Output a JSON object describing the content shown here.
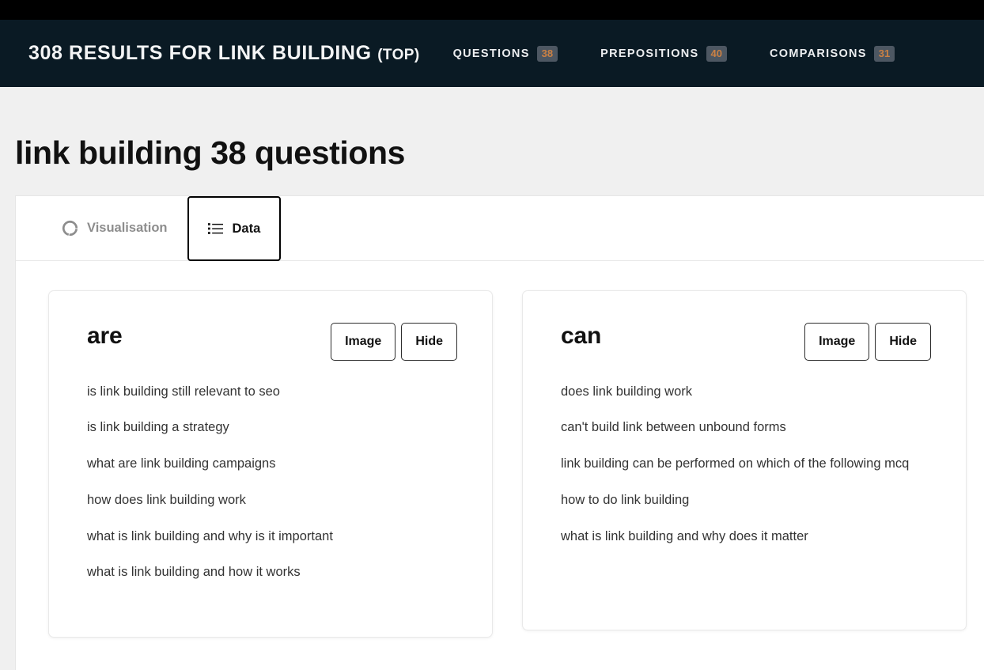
{
  "header": {
    "title_main": "308 RESULTS FOR LINK BUILDING",
    "title_suffix": "(TOP)",
    "nav": [
      {
        "label": "QUESTIONS",
        "count": "38"
      },
      {
        "label": "PREPOSITIONS",
        "count": "40"
      },
      {
        "label": "COMPARISONS",
        "count": "31"
      }
    ],
    "colors": {
      "bar_background": "#0a1a24",
      "top_strip": "#000000",
      "badge_background": "#4d5762",
      "badge_text": "#cb8144"
    }
  },
  "page": {
    "title": "link building 38 questions",
    "background": "#f0f0f0"
  },
  "tabs": [
    {
      "label": "Visualisation",
      "icon": "donut-chart-icon",
      "active": false
    },
    {
      "label": "Data",
      "icon": "list-icon",
      "active": true
    }
  ],
  "cards": [
    {
      "title": "are",
      "image_label": "Image",
      "hide_label": "Hide",
      "items": [
        "is link building still relevant to seo",
        "is link building a strategy",
        "what are link building campaigns",
        "how does link building work",
        "what is link building and why is it important",
        "what is link building and how it works"
      ]
    },
    {
      "title": "can",
      "image_label": "Image",
      "hide_label": "Hide",
      "items": [
        "does link building work",
        "can't build link between unbound forms",
        "link building can be performed on which of the following mcq",
        "how to do link building",
        "what is link building and why does it matter"
      ]
    }
  ]
}
